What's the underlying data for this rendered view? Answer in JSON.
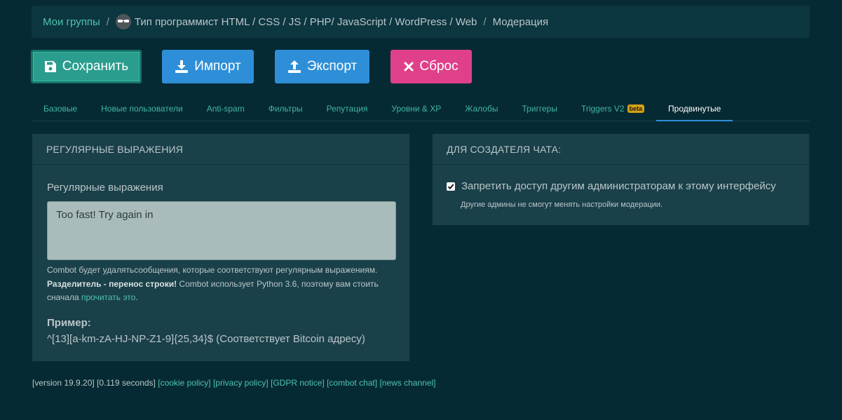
{
  "breadcrumb": {
    "home": "Мои группы",
    "group": "Тип программист HTML / CSS / JS / PHP/ JavaScript / WordPress / Web",
    "current": "Модерация",
    "separator": "/"
  },
  "toolbar": {
    "save": "Сохранить",
    "import": "Импорт",
    "export": "Экспорт",
    "reset": "Сброс"
  },
  "tabs": [
    {
      "label": "Базовые"
    },
    {
      "label": "Новые пользователи"
    },
    {
      "label": "Anti-spam"
    },
    {
      "label": "Фильтры"
    },
    {
      "label": "Репутация"
    },
    {
      "label": "Уровни & XP"
    },
    {
      "label": "Жалобы"
    },
    {
      "label": "Триггеры"
    },
    {
      "label": "Triggers V2",
      "badge": "beta"
    },
    {
      "label": "Продвинутые",
      "active": true
    }
  ],
  "regex_panel": {
    "title": "РЕГУЛЯРНЫЕ ВЫРАЖЕНИЯ",
    "field_label": "Регулярные выражения",
    "value": "Too fast! Try again in",
    "help_1": "Combot будет удалятьсообщения, которые соответствуют регулярным выражениям.",
    "help_bold": "Разделитель - перенос строки!",
    "help_2": " Combot использует Python 3.6, поэтому вам стоить сначала ",
    "help_link": "прочитать это",
    "help_end": ".",
    "example_title": "Пример:",
    "example_value": "^[13][a-km-zA-HJ-NP-Z1-9]{25,34}$ (Соответствует Bitcoin адресу)"
  },
  "creator_panel": {
    "title": "ДЛЯ СОЗДАТЕЛЯ ЧАТА:",
    "checkbox_label": "Запретить доступ другим администраторам к этому интерфейсу",
    "checkbox_checked": true,
    "checkbox_desc": "Другие админы не смогут менять настройки модерации."
  },
  "footer": {
    "version": "[version 19.9.20] [0.119 seconds]",
    "links": [
      "[cookie policy]",
      "[privacy policy]",
      "[GDPR notice]",
      "[combot chat]",
      "[news channel]"
    ]
  },
  "colors": {
    "background": "#062a33",
    "panel": "#1a4049",
    "accent_link": "#4fc3b0",
    "save": "#2a9d8f",
    "import_export": "#2e8fd8",
    "reset": "#e0408a"
  }
}
